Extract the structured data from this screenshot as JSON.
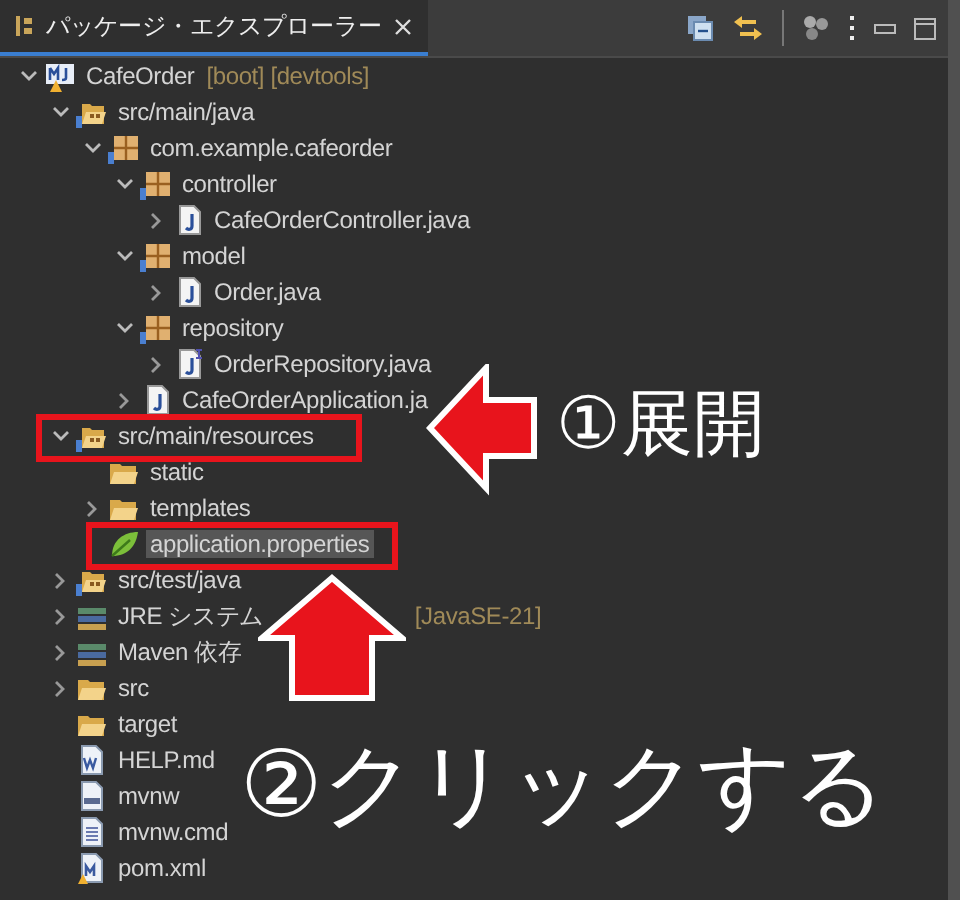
{
  "tabs": [
    {
      "label": "パッケージ・エクスプローラー",
      "selected": true
    }
  ],
  "tree": [
    {
      "kind": "project",
      "label": "CafeOrder",
      "decoration": "[boot] [devtools]",
      "expanded": true,
      "selected": false,
      "children": [
        {
          "kind": "srcfolder",
          "label": "src/main/java",
          "expanded": true,
          "selected": false,
          "children": [
            {
              "kind": "package",
              "label": "com.example.cafeorder",
              "expanded": true,
              "selected": false,
              "children": [
                {
                  "kind": "package",
                  "label": "controller",
                  "expanded": true,
                  "selected": false,
                  "children": [
                    {
                      "kind": "java",
                      "label": "CafeOrderController.java",
                      "expanded": false,
                      "selected": false
                    }
                  ]
                },
                {
                  "kind": "package",
                  "label": "model",
                  "expanded": true,
                  "selected": false,
                  "children": [
                    {
                      "kind": "java",
                      "label": "Order.java",
                      "expanded": false,
                      "selected": false
                    }
                  ]
                },
                {
                  "kind": "package",
                  "label": "repository",
                  "expanded": true,
                  "selected": false,
                  "children": [
                    {
                      "kind": "interface",
                      "label": "OrderRepository.java",
                      "expanded": false,
                      "selected": false
                    }
                  ]
                },
                {
                  "kind": "java",
                  "label": "CafeOrderApplication.ja",
                  "expanded": false,
                  "selected": false
                }
              ]
            }
          ]
        },
        {
          "kind": "srcfolder",
          "label": "src/main/resources",
          "expanded": true,
          "selected": false,
          "children": [
            {
              "kind": "folder",
              "label": "static",
              "selected": false
            },
            {
              "kind": "folder",
              "label": "templates",
              "expanded": false,
              "selected": false
            },
            {
              "kind": "properties",
              "label": "application.properties",
              "selected": true
            }
          ]
        },
        {
          "kind": "srcfolder",
          "label": "src/test/java",
          "expanded": false,
          "selected": false
        },
        {
          "kind": "library",
          "label": "JRE システム",
          "decoration": "[JavaSE-21]",
          "expanded": false,
          "selected": false
        },
        {
          "kind": "library",
          "label": "Maven 依存",
          "expanded": false,
          "selected": false
        },
        {
          "kind": "folder",
          "label": "src",
          "expanded": false,
          "selected": false
        },
        {
          "kind": "folder",
          "label": "target",
          "selected": false
        },
        {
          "kind": "md",
          "label": "HELP.md",
          "selected": false
        },
        {
          "kind": "binary",
          "label": "mvnw",
          "selected": false
        },
        {
          "kind": "text",
          "label": "mvnw.cmd",
          "selected": false
        },
        {
          "kind": "xml",
          "label": "pom.xml",
          "selected": false
        }
      ]
    }
  ],
  "annotations": [
    {
      "kind": "step",
      "text": "①展開"
    },
    {
      "kind": "step",
      "text": "②クリックする"
    }
  ]
}
